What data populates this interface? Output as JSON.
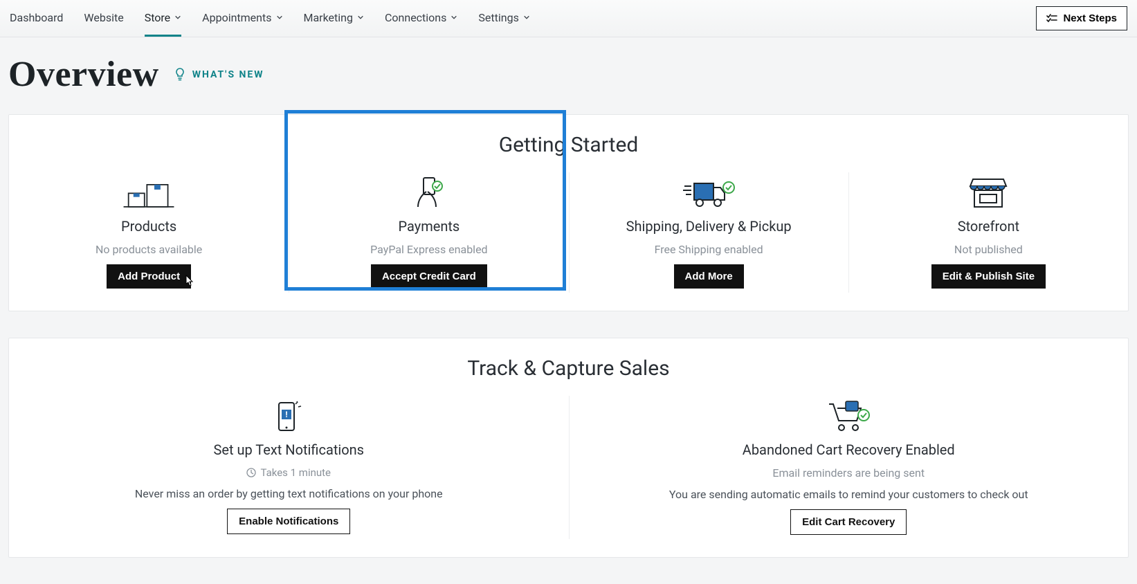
{
  "nav": {
    "items": [
      {
        "label": "Dashboard",
        "dropdown": false
      },
      {
        "label": "Website",
        "dropdown": false
      },
      {
        "label": "Store",
        "dropdown": true
      },
      {
        "label": "Appointments",
        "dropdown": true
      },
      {
        "label": "Marketing",
        "dropdown": true
      },
      {
        "label": "Connections",
        "dropdown": true
      },
      {
        "label": "Settings",
        "dropdown": true
      }
    ],
    "active_index": 2,
    "next_steps_label": "Next Steps"
  },
  "header": {
    "title": "Overview",
    "whats_new_label": "WHAT'S NEW"
  },
  "getting_started": {
    "title": "Getting Started",
    "cards": [
      {
        "title": "Products",
        "subtitle": "No products available",
        "button": "Add Product"
      },
      {
        "title": "Payments",
        "subtitle": "PayPal Express enabled",
        "button": "Accept Credit Card"
      },
      {
        "title": "Shipping, Delivery & Pickup",
        "subtitle": "Free Shipping enabled",
        "button": "Add More"
      },
      {
        "title": "Storefront",
        "subtitle": "Not published",
        "button": "Edit & Publish Site"
      }
    ]
  },
  "track_sales": {
    "title": "Track & Capture Sales",
    "cards": [
      {
        "title": "Set up Text Notifications",
        "meta": "Takes 1 minute",
        "description": "Never miss an order by getting text notifications on your phone",
        "button": "Enable Notifications"
      },
      {
        "title": "Abandoned Cart Recovery Enabled",
        "meta": "Email reminders are being sent",
        "description": "You are sending automatic emails to remind your customers to check out",
        "button": "Edit Cart Recovery"
      }
    ]
  }
}
